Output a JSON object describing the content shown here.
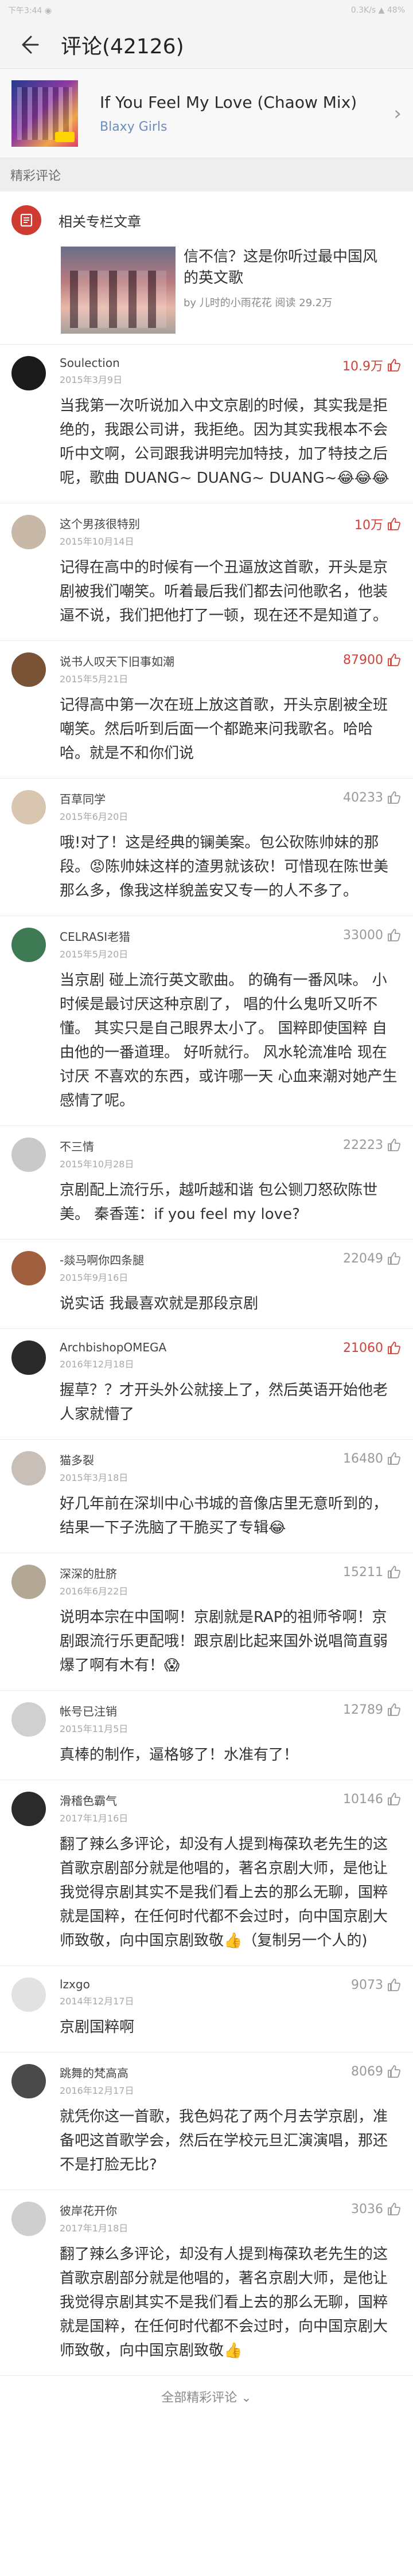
{
  "status_bar": {
    "left": "下午3:44 ◉",
    "right": "0.3K/s ▲ 48%"
  },
  "header": {
    "title": "评论(42126)"
  },
  "song": {
    "title": "If You Feel My Love (Chaow Mix)",
    "artist": "Blaxy Girls"
  },
  "section": {
    "title": "精彩评论"
  },
  "column": {
    "label": "相关专栏文章",
    "article_title": "信不信？这是你听过最中国风的英文歌",
    "article_meta": "by 儿时的小雨花花  阅读 29.2万"
  },
  "colors": {
    "accent": "#d2413b",
    "like_hot": "#d2413b",
    "like_cold": "#9a9a9a",
    "artist": "#6a8cc0"
  },
  "comments": [
    {
      "user": "Soulection",
      "date": "2015年3月9日",
      "likes": "10.9万",
      "hot": true,
      "avatar_color": "#1a1a1a",
      "text": "当我第一次听说加入中文京剧的时候，其实我是拒绝的，我跟公司讲，我拒绝。因为其实我根本不会听中文啊，公司跟我讲明完加特技，加了特技之后呢，歌曲 DUANG~ DUANG~ DUANG~😂😂😂"
    },
    {
      "user": "这个男孩很特别",
      "date": "2015年10月14日",
      "likes": "10万",
      "hot": true,
      "avatar_color": "#c8b8a8",
      "text": "记得在高中的时候有一个丑逼放这首歌，开头是京剧被我们嘲笑。听着最后我们都去问他歌名，他装逼不说，我们把他打了一顿，现在还不是知道了。"
    },
    {
      "user": "说书人叹天下旧事如潮",
      "date": "2015年5月21日",
      "likes": "87900",
      "hot": true,
      "avatar_color": "#7a5236",
      "text": "记得高中第一次在班上放这首歌，开头京剧被全班嘲笑。然后听到后面一个都跪来问我歌名。哈哈哈。就是不和你们说"
    },
    {
      "user": "百草同学",
      "date": "2015年6月20日",
      "likes": "40233",
      "hot": false,
      "avatar_color": "#d9c6b0",
      "text": "哦!对了！这是经典的镧美案。包公砍陈帅妹的那段。😡陈帅妹这样的渣男就该砍！可惜现在陈世美那么多，像我这样貌盖安又专一的人不多了。"
    },
    {
      "user": "CELRASI老猎",
      "date": "2015年5月20日",
      "likes": "33000",
      "hot": false,
      "avatar_color": "#3e7a54",
      "text": "当京剧  碰上流行英文歌曲。      的确有一番风味。  小时候是最讨厌这种京剧了，  唱的什么鬼听又听不懂。  其实只是自己眼界太小了。  国粹即使国粹  自由他的一番道理。  好听就行。  风水轮流准哈  现在讨厌 不喜欢的东西，或许哪一天 心血来潮对她产生感情了呢。"
    },
    {
      "user": "不三情",
      "date": "2015年10月28日",
      "likes": "22223",
      "hot": false,
      "avatar_color": "#c9c9c9",
      "text": "京剧配上流行乐，越听越和谐                    包公铡刀怒砍陈世美。                              秦香莲：if you feel my love?"
    },
    {
      "user": "-燚马啊你四条腿",
      "date": "2015年9月16日",
      "likes": "22049",
      "hot": false,
      "avatar_color": "#a0603f",
      "text": "说实话  我最喜欢就是那段京剧"
    },
    {
      "user": "ArchbishopOMEGA",
      "date": "2016年12月18日",
      "likes": "21060",
      "hot": true,
      "avatar_color": "#2a2a2a",
      "text": "握草？？才开头外公就接上了，然后英语开始他老人家就懵了"
    },
    {
      "user": "猫多裂",
      "date": "2015年3月18日",
      "likes": "16480",
      "hot": false,
      "avatar_color": "#c8c0b8",
      "text": "好几年前在深圳中心书城的音像店里无意听到的，结果一下子洗脑了干脆买了专辑😂"
    },
    {
      "user": "深深的肚脐",
      "date": "2016年6月22日",
      "likes": "15211",
      "hot": false,
      "avatar_color": "#b3a796",
      "text": "说明本宗在中国啊！京剧就是RAP的祖师爷啊！京剧跟流行乐更配哦！跟京剧比起来国外说唱简直弱爆了啊有木有！😱"
    },
    {
      "user": "帐号已注销",
      "date": "2015年11月5日",
      "likes": "12789",
      "hot": false,
      "avatar_color": "#d0d0d0",
      "text": "真棒的制作，逼格够了！水准有了！"
    },
    {
      "user": "滑稽色霸气",
      "date": "2017年1月16日",
      "likes": "10146",
      "hot": false,
      "avatar_color": "#2b2b2b",
      "text": "翻了辣么多评论，却没有人提到梅葆玖老先生的这首歌京剧部分就是他唱的，著名京剧大师，是他让我觉得京剧其实不是我们看上去的那么无聊，国粹就是国粹，在任何时代都不会过时，向中国京剧大师致敬，向中国京剧致敬👍（复制另一个人的)"
    },
    {
      "user": "lzxgo",
      "date": "2014年12月17日",
      "likes": "9073",
      "hot": false,
      "avatar_color": "#e2e2e2",
      "text": "京剧国粹啊"
    },
    {
      "user": "跳舞的梵高高",
      "date": "2016年12月17日",
      "likes": "8069",
      "hot": false,
      "avatar_color": "#4a4a4a",
      "text": "就凭你这一首歌，我色妈花了两个月去学京剧，准备吧这首歌学会，然后在学校元旦汇演演唱，那还不是打脸无比?"
    },
    {
      "user": "彼岸花开你",
      "date": "2017年1月18日",
      "likes": "3036",
      "hot": false,
      "avatar_color": "#cfcfcf",
      "text": "翻了辣么多评论，却没有人提到梅葆玖老先生的这首歌京剧部分就是他唱的，著名京剧大师，是他让我觉得京剧其实不是我们看上去的那么无聊，国粹就是国粹，在任何时代都不会过时，向中国京剧大师致敬，向中国京剧致敬👍"
    }
  ],
  "footer": {
    "label": "全部精彩评论 ⌄"
  }
}
